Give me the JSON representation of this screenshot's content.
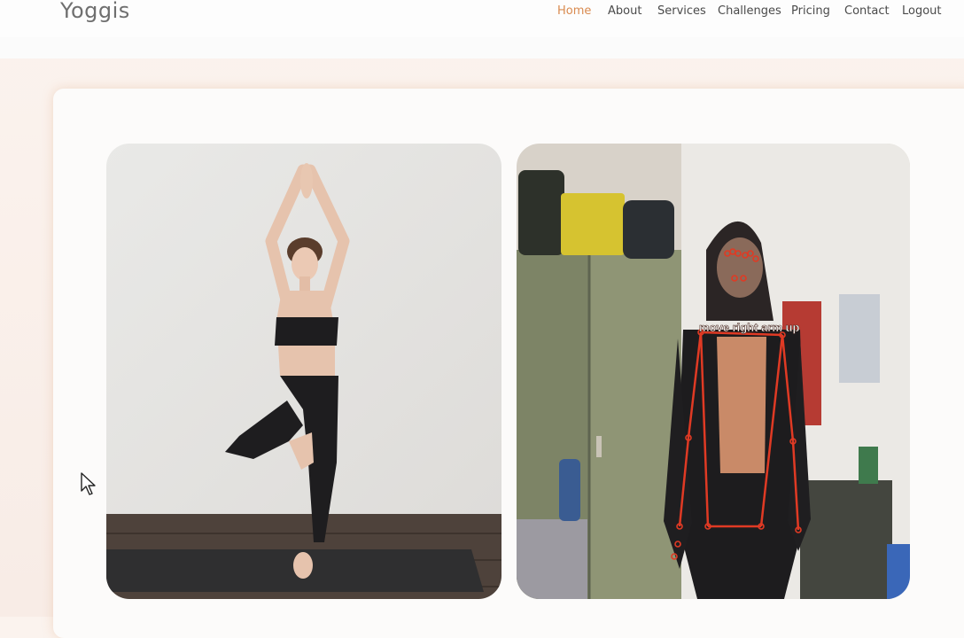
{
  "brand": {
    "name": "Yoggis"
  },
  "nav": {
    "items": [
      {
        "label": "Home",
        "active": true
      },
      {
        "label": "About"
      },
      {
        "label": "Services"
      },
      {
        "label": "Challenges"
      },
      {
        "label": "Pricing"
      },
      {
        "label": "Contact"
      },
      {
        "label": "Logout"
      }
    ],
    "active_color": "#d98a4f"
  },
  "panels": {
    "reference_image": {
      "icon": "yoga-tree-pose-image"
    },
    "webcam_feed": {
      "icon": "pose-detection-feed",
      "overlay_text": "move right arm up"
    }
  }
}
